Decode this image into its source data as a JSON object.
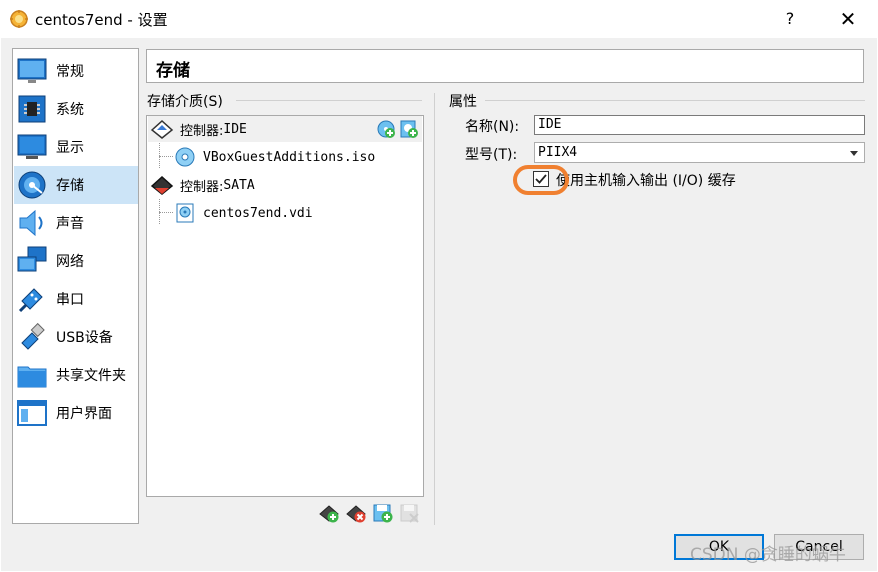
{
  "window": {
    "title": "centos7end - 设置",
    "help_glyph": "?",
    "close_glyph": "✕"
  },
  "sidebar": {
    "items": [
      {
        "label": "常规",
        "icon": "general-monitor-icon"
      },
      {
        "label": "系统",
        "icon": "system-chip-icon"
      },
      {
        "label": "显示",
        "icon": "display-monitor-icon"
      },
      {
        "label": "存储",
        "icon": "storage-disk-icon",
        "selected": true
      },
      {
        "label": "声音",
        "icon": "speaker-icon"
      },
      {
        "label": "网络",
        "icon": "network-icon"
      },
      {
        "label": "串口",
        "icon": "serial-port-icon"
      },
      {
        "label": "USB设备",
        "icon": "usb-icon"
      },
      {
        "label": "共享文件夹",
        "icon": "shared-folder-icon"
      },
      {
        "label": "用户界面",
        "icon": "user-interface-icon"
      }
    ]
  },
  "page": {
    "title": "存储"
  },
  "storage": {
    "group_label": "存储介质(S)",
    "tree": [
      {
        "label_prefix": "控制器: ",
        "label_value": "IDE",
        "type": "controller",
        "selected": true
      },
      {
        "label": "VBoxGuestAdditions.iso",
        "type": "optical"
      },
      {
        "label_prefix": "控制器: ",
        "label_value": "SATA",
        "type": "controller"
      },
      {
        "label": "centos7end.vdi",
        "type": "hard-disk"
      }
    ]
  },
  "properties": {
    "group_label": "属性",
    "name_label": "名称(N):",
    "name_value": "IDE",
    "type_label": "型号(T):",
    "type_value": "PIIX4",
    "host_io_cache_label": "使用主机输入输出 (I/O) 缓存",
    "host_io_cache_checked": true,
    "highlight_color": "#f08030"
  },
  "buttons": {
    "ok": "OK",
    "cancel": "Cancel"
  },
  "watermark": "CSDN @贪睡的蜗牛",
  "colors": {
    "selection": "#cce4f7",
    "default_button_border": "#0078d7"
  }
}
